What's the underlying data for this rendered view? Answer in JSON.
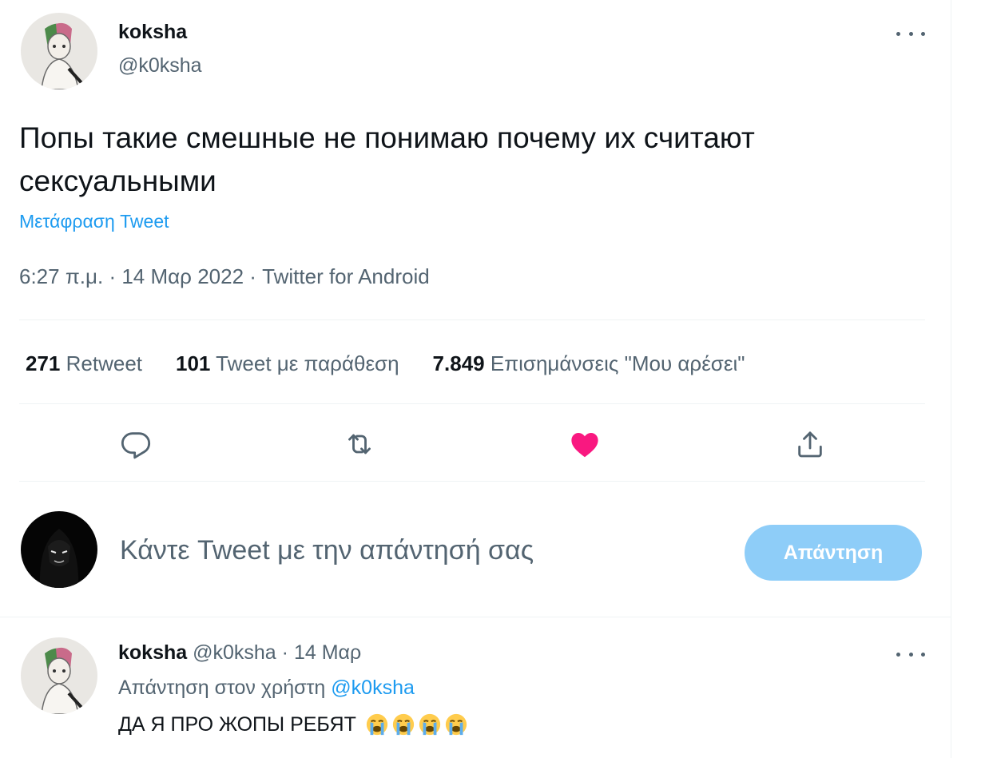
{
  "tweet": {
    "display_name": "koksha",
    "handle": "@k0ksha",
    "text": "Попы такие смешные не понимаю почему их считают сексуальными",
    "translate_label": "Μετάφραση Tweet",
    "time": "6:27 π.μ.",
    "date": "14 Μαρ 2022",
    "source": "Twitter for Android",
    "separator": "·"
  },
  "stats": [
    {
      "count": "271",
      "label": "Retweet"
    },
    {
      "count": "101",
      "label": "Tweet με παράθεση"
    },
    {
      "count": "7.849",
      "label": "Επισημάνσεις \"Μου αρέσει\""
    }
  ],
  "actions": {
    "reply_icon": "reply-icon",
    "retweet_icon": "retweet-icon",
    "like_icon": "heart-icon",
    "share_icon": "share-icon",
    "like_color": "#f91880",
    "accent_color": "#1d9bf0"
  },
  "composer": {
    "placeholder": "Κάντε Tweet με την απάντησή σας",
    "button_label": "Απάντηση"
  },
  "reply": {
    "display_name": "koksha",
    "handle": "@k0ksha",
    "date": "14 Μαρ",
    "replying_prefix": "Απάντηση στον χρήστη",
    "replying_to": "@k0ksha",
    "text": "ДА Я ПРО ЖОПЫ РЕБЯТ",
    "emoji": "😭"
  }
}
